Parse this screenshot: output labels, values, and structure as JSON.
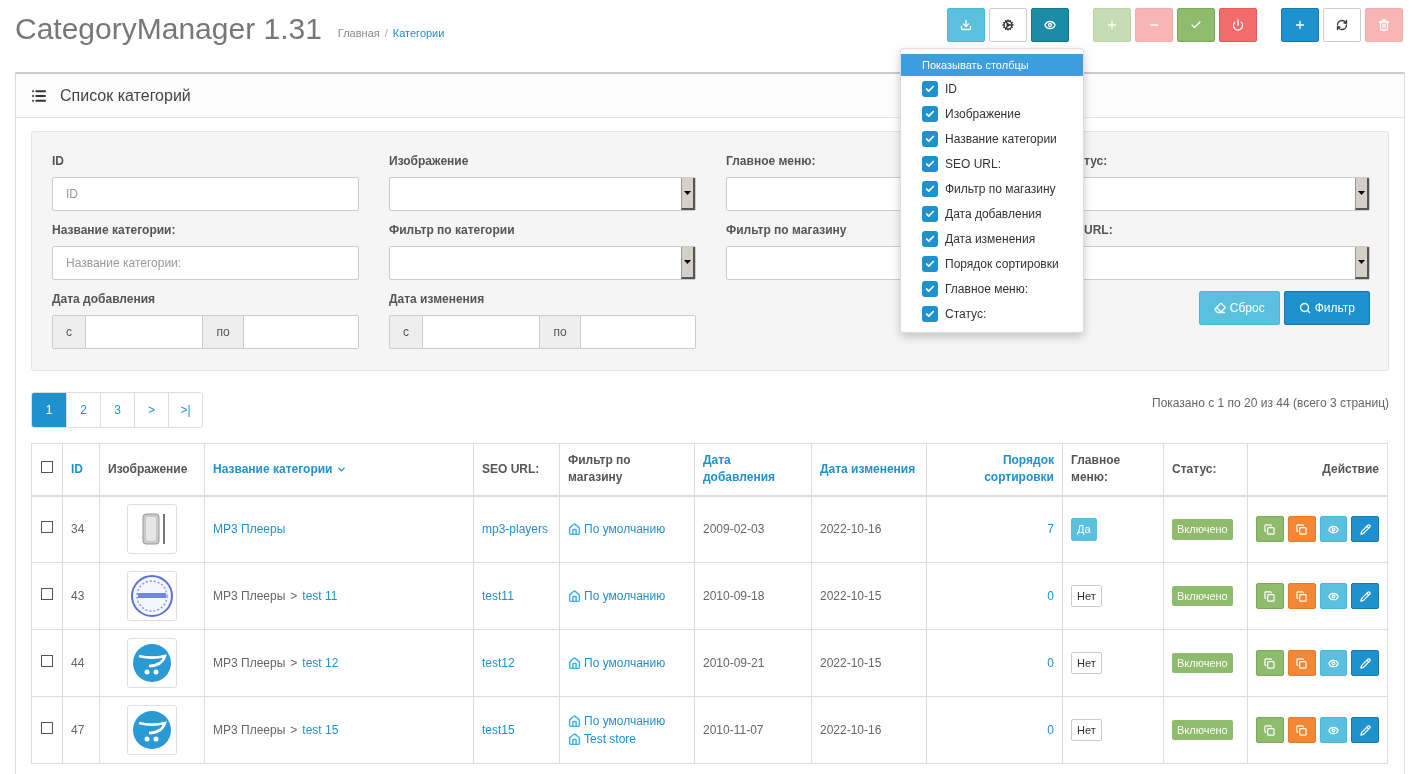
{
  "header": {
    "title": "CategoryManager 1.31",
    "separator": "/",
    "breadcrumbs": [
      {
        "label": "Главная",
        "current": false
      },
      {
        "label": "Категории",
        "current": true
      }
    ]
  },
  "toolbar": [
    [
      {
        "disabled": false,
        "selected": false
      },
      {
        "disabled": false,
        "selected": false
      },
      {
        "disabled": false,
        "selected": true
      }
    ],
    [
      {
        "disabled": true,
        "selected": false
      },
      {
        "disabled": true,
        "selected": false
      },
      {
        "disabled": false,
        "selected": false
      },
      {
        "disabled": false,
        "selected": false
      }
    ],
    [
      {
        "disabled": false,
        "selected": false
      },
      {
        "disabled": false,
        "selected": false
      },
      {
        "disabled": true,
        "selected": false
      }
    ]
  ],
  "columns_menu": {
    "title": "Показывать столбцы",
    "items": [
      {
        "label": "ID",
        "checked": true
      },
      {
        "label": "Изображение",
        "checked": true
      },
      {
        "label": "Название категории",
        "checked": true
      },
      {
        "label": "SEO URL:",
        "checked": true
      },
      {
        "label": "Фильтр по магазину",
        "checked": true
      },
      {
        "label": "Дата добавления",
        "checked": true
      },
      {
        "label": "Дата изменения",
        "checked": true
      },
      {
        "label": "Порядок сортировки",
        "checked": true
      },
      {
        "label": "Главное меню:",
        "checked": true
      },
      {
        "label": "Статус:",
        "checked": true
      }
    ]
  },
  "panel": {
    "title": "Список категорий"
  },
  "filters": [
    {
      "label": "ID",
      "kind": "text",
      "placeholder": "ID"
    },
    {
      "label": "Изображение",
      "kind": "select"
    },
    {
      "label": "Главное меню:",
      "kind": "select"
    },
    {
      "label": "тус:",
      "kind": "select"
    },
    {
      "label": "Название категории:",
      "kind": "text",
      "placeholder": "Название категории:"
    },
    {
      "label": "Фильтр по категории",
      "kind": "select"
    },
    {
      "label": "Фильтр по магазину",
      "kind": "select"
    },
    {
      "label": "URL:",
      "kind": "select"
    },
    {
      "label": "Дата добавления",
      "kind": "range",
      "from": "с",
      "to": "по"
    },
    {
      "label": "Дата изменения",
      "kind": "range",
      "from": "с",
      "to": "по"
    }
  ],
  "filter_buttons": [
    "Сброс",
    "Фильтр"
  ],
  "pagination": [
    {
      "label": "1",
      "selected": true
    },
    {
      "label": "2",
      "selected": false
    },
    {
      "label": "3",
      "selected": false
    },
    {
      "label": ">",
      "selected": false
    },
    {
      "label": ">|",
      "selected": false
    }
  ],
  "summary": "Показано с 1 по 20 из 44 (всего 3 страниц)",
  "table": {
    "select_all_checked": false,
    "columns": [
      {
        "label": "ID",
        "sortable": true,
        "sorted": false
      },
      {
        "label": "Изображение",
        "sortable": false
      },
      {
        "label": "Название категории",
        "sortable": true,
        "sorted": true
      },
      {
        "label": "SEO URL:",
        "sortable": false
      },
      {
        "label": "Фильтр по магазину",
        "sortable": false
      },
      {
        "label": "Дата добавления",
        "sortable": true,
        "sorted": false
      },
      {
        "label": "Дата изменения",
        "sortable": true,
        "sorted": false
      },
      {
        "label": "Порядок сортировки",
        "sortable": true,
        "sorted": false
      },
      {
        "label": "Главное меню:",
        "sortable": false
      },
      {
        "label": "Статус:",
        "sortable": false
      },
      {
        "label": "Действие",
        "sortable": false
      }
    ],
    "rows": [
      {
        "checked": false,
        "id": "34",
        "category": {
          "name": "MP3 Плееры"
        },
        "seo": "mp3-players",
        "stores": [
          "По умолчанию"
        ],
        "date_added": "2009-02-03",
        "date_modified": "2022-10-16",
        "sort": "7",
        "main_menu": {
          "label": "Да",
          "on": true
        },
        "status": "Включено"
      },
      {
        "checked": false,
        "id": "43",
        "category": {
          "path": [
            {
              "label": "MP3 Плееры",
              "separator": ">"
            }
          ],
          "name": "test 11"
        },
        "seo": "test11",
        "stores": [
          "По умолчанию"
        ],
        "date_added": "2010-09-18",
        "date_modified": "2022-10-15",
        "sort": "0",
        "main_menu": {
          "label": "Нет",
          "on": false
        },
        "status": "Включено"
      },
      {
        "checked": false,
        "id": "44",
        "category": {
          "path": [
            {
              "label": "MP3 Плееры",
              "separator": ">"
            }
          ],
          "name": "test 12"
        },
        "seo": "test12",
        "stores": [
          "По умолчанию"
        ],
        "date_added": "2010-09-21",
        "date_modified": "2022-10-15",
        "sort": "0",
        "main_menu": {
          "label": "Нет",
          "on": false
        },
        "status": "Включено"
      },
      {
        "checked": false,
        "id": "47",
        "category": {
          "path": [
            {
              "label": "MP3 Плееры",
              "separator": ">"
            }
          ],
          "name": "test 15"
        },
        "seo": "test15",
        "stores": [
          "По умолчанию",
          "Test store"
        ],
        "date_added": "2010-11-07",
        "date_modified": "2022-10-16",
        "sort": "0",
        "main_menu": {
          "label": "Нет",
          "on": false
        },
        "status": "Включено"
      }
    ]
  }
}
